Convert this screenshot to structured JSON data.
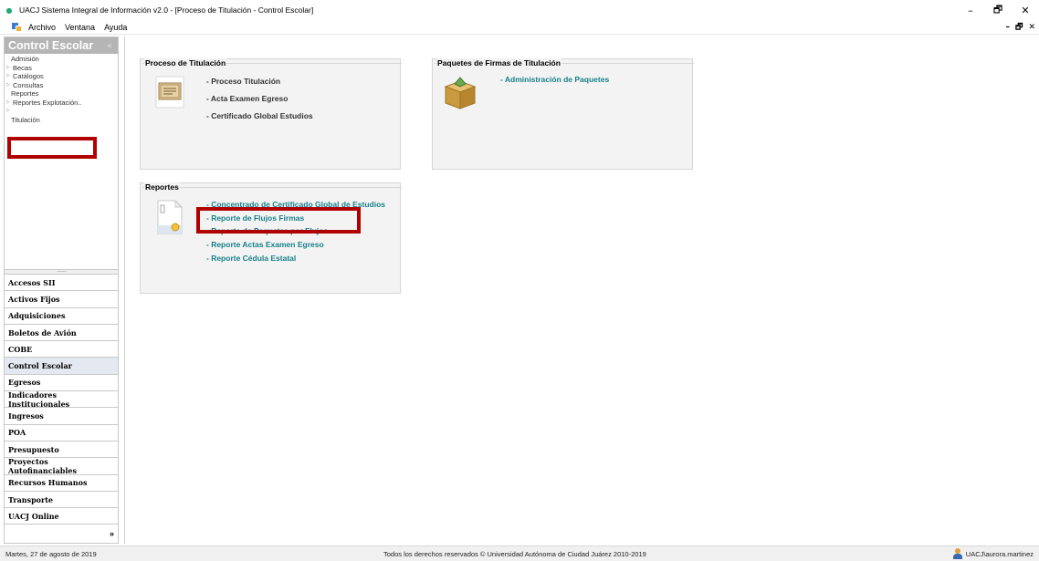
{
  "window": {
    "title": "UACJ Sistema Integral de Información v2.0 - [Proceso de Titulación - Control Escolar]",
    "minimize": "–",
    "restore": "🗗",
    "close": "✕"
  },
  "menu": {
    "items": [
      "Archivo",
      "Ventana",
      "Ayuda"
    ],
    "mdi_controls": [
      "–",
      "🗗",
      "✕"
    ]
  },
  "left_panel": {
    "title": "Control Escolar",
    "collapse_glyph": "«",
    "tree": [
      {
        "label": "Admisión",
        "expandable": false
      },
      {
        "label": "Becas",
        "expandable": true
      },
      {
        "label": "Catálogos",
        "expandable": true
      },
      {
        "label": "Consultas",
        "expandable": true
      },
      {
        "label": "Reportes",
        "expandable": false
      },
      {
        "label": "Reportes  Explotación..",
        "expandable": true
      },
      {
        "label": "Titulación",
        "expandable": false
      }
    ],
    "splitter_glyph": "··········",
    "modules": [
      "Accesos SII",
      "Activos Fijos",
      "Adquisiciones",
      "Boletos de Avión",
      "COBE",
      "Control Escolar",
      "Egresos",
      "Indicadores Institucionales",
      "Ingresos",
      "POA",
      "Presupuesto",
      "Proyectos Autofinanciables",
      "Recursos Humanos",
      "Transporte",
      "UACJ Online"
    ],
    "active_module": "Control Escolar",
    "more_glyph": "»"
  },
  "main": {
    "proceso": {
      "title": "Proceso de Titulación",
      "links": [
        "- Proceso Titulación",
        "- Acta Examen Egreso",
        "- Certificado Global Estudios"
      ]
    },
    "paquetes": {
      "title": "Paquetes de Firmas de Titulación",
      "links": [
        "- Administración de Paquetes"
      ]
    },
    "reportes": {
      "title": "Reportes",
      "links": [
        "- Concentrado de Certificado Global de Estudios",
        "- Reporte de Flujos Firmas",
        "- Reporte de Paquetes por Flujos",
        "- Reporte Actas Examen Egreso",
        "- Reporte Cédula Estatal"
      ]
    }
  },
  "status": {
    "date": "Martes, 27 de agosto de 2019",
    "copyright": "Todos los derechos reservados © Universidad Autónoma de Ciudad Juárez 2010-2019",
    "user": "UACJ\\aurora.martinez"
  },
  "colors": {
    "link_teal": "#17808a",
    "highlight_red": "#b00000",
    "panel_header": "#b5b5b5"
  }
}
